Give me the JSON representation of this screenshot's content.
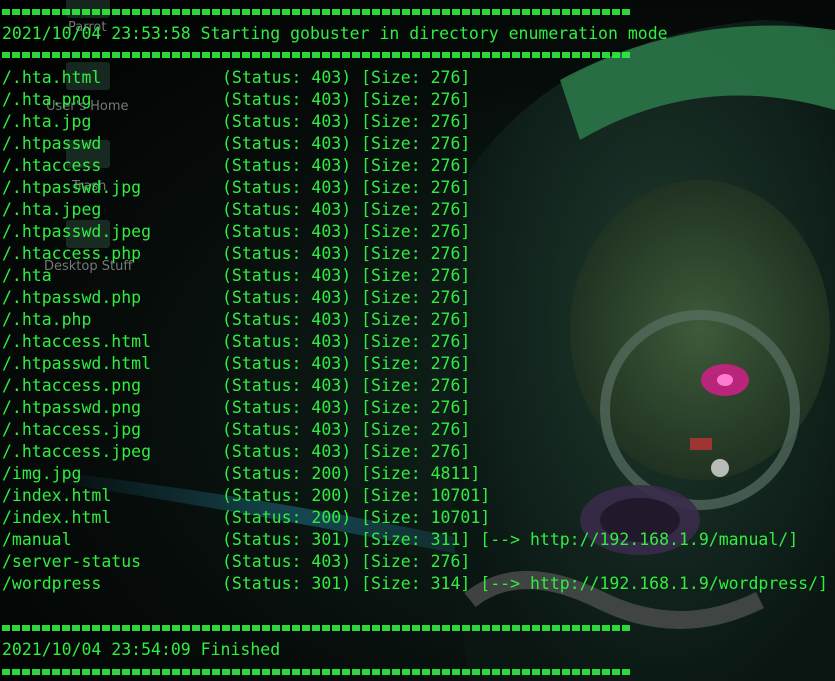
{
  "desktop": {
    "icons": [
      {
        "label": "Parrot"
      },
      {
        "label": "User's Home"
      },
      {
        "label": "Trash"
      },
      {
        "label": "Desktop Stuff"
      }
    ]
  },
  "terminal": {
    "start_line": "2021/10/04 23:53:58 Starting gobuster in directory enumeration mode",
    "results": [
      {
        "path": "/.hta.html",
        "status": "(Status: 403) [Size: 276]"
      },
      {
        "path": "/.hta.png",
        "status": "(Status: 403) [Size: 276]"
      },
      {
        "path": "/.hta.jpg",
        "status": "(Status: 403) [Size: 276]"
      },
      {
        "path": "/.htpasswd",
        "status": "(Status: 403) [Size: 276]"
      },
      {
        "path": "/.htaccess",
        "status": "(Status: 403) [Size: 276]"
      },
      {
        "path": "/.htpasswd.jpg",
        "status": "(Status: 403) [Size: 276]"
      },
      {
        "path": "/.hta.jpeg",
        "status": "(Status: 403) [Size: 276]"
      },
      {
        "path": "/.htpasswd.jpeg",
        "status": "(Status: 403) [Size: 276]"
      },
      {
        "path": "/.htaccess.php",
        "status": "(Status: 403) [Size: 276]"
      },
      {
        "path": "/.hta",
        "status": "(Status: 403) [Size: 276]"
      },
      {
        "path": "/.htpasswd.php",
        "status": "(Status: 403) [Size: 276]"
      },
      {
        "path": "/.hta.php",
        "status": "(Status: 403) [Size: 276]"
      },
      {
        "path": "/.htaccess.html",
        "status": "(Status: 403) [Size: 276]"
      },
      {
        "path": "/.htpasswd.html",
        "status": "(Status: 403) [Size: 276]"
      },
      {
        "path": "/.htaccess.png",
        "status": "(Status: 403) [Size: 276]"
      },
      {
        "path": "/.htpasswd.png",
        "status": "(Status: 403) [Size: 276]"
      },
      {
        "path": "/.htaccess.jpg",
        "status": "(Status: 403) [Size: 276]"
      },
      {
        "path": "/.htaccess.jpeg",
        "status": "(Status: 403) [Size: 276]"
      },
      {
        "path": "/img.jpg",
        "status": "(Status: 200) [Size: 4811]"
      },
      {
        "path": "/index.html",
        "status": "(Status: 200) [Size: 10701]"
      },
      {
        "path": "/index.html",
        "status": "(Status: 200) [Size: 10701]"
      },
      {
        "path": "/manual",
        "status": "(Status: 301) [Size: 311] [--> http://192.168.1.9/manual/]"
      },
      {
        "path": "/server-status",
        "status": "(Status: 403) [Size: 276]"
      },
      {
        "path": "/wordpress",
        "status": "(Status: 301) [Size: 314] [--> http://192.168.1.9/wordpress/]"
      }
    ],
    "finish_line": "2021/10/04 23:54:09 Finished",
    "text_color": "#30ee40"
  }
}
